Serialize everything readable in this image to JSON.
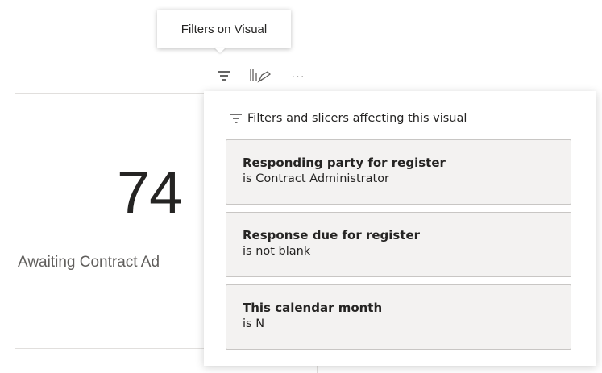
{
  "tooltip": {
    "text": "Filters on Visual"
  },
  "visual_header": {
    "filter_icon": "filter-icon",
    "focus_icon": "focus-mode-icon",
    "more_label": "···"
  },
  "card": {
    "value": "74",
    "label": "Awaiting Contract Ad"
  },
  "flyout": {
    "header": "Filters and slicers affecting this visual",
    "filters": [
      {
        "name": "Responding party for register",
        "condition": "is Contract Administrator"
      },
      {
        "name": "Response due for register",
        "condition": "is not blank"
      },
      {
        "name": "This calendar month",
        "condition": "is N"
      }
    ]
  },
  "colors": {
    "item_background": "#f3f2f1",
    "item_border": "#c8c6c4",
    "text": "#252423",
    "subtle_text": "#605e5c"
  }
}
